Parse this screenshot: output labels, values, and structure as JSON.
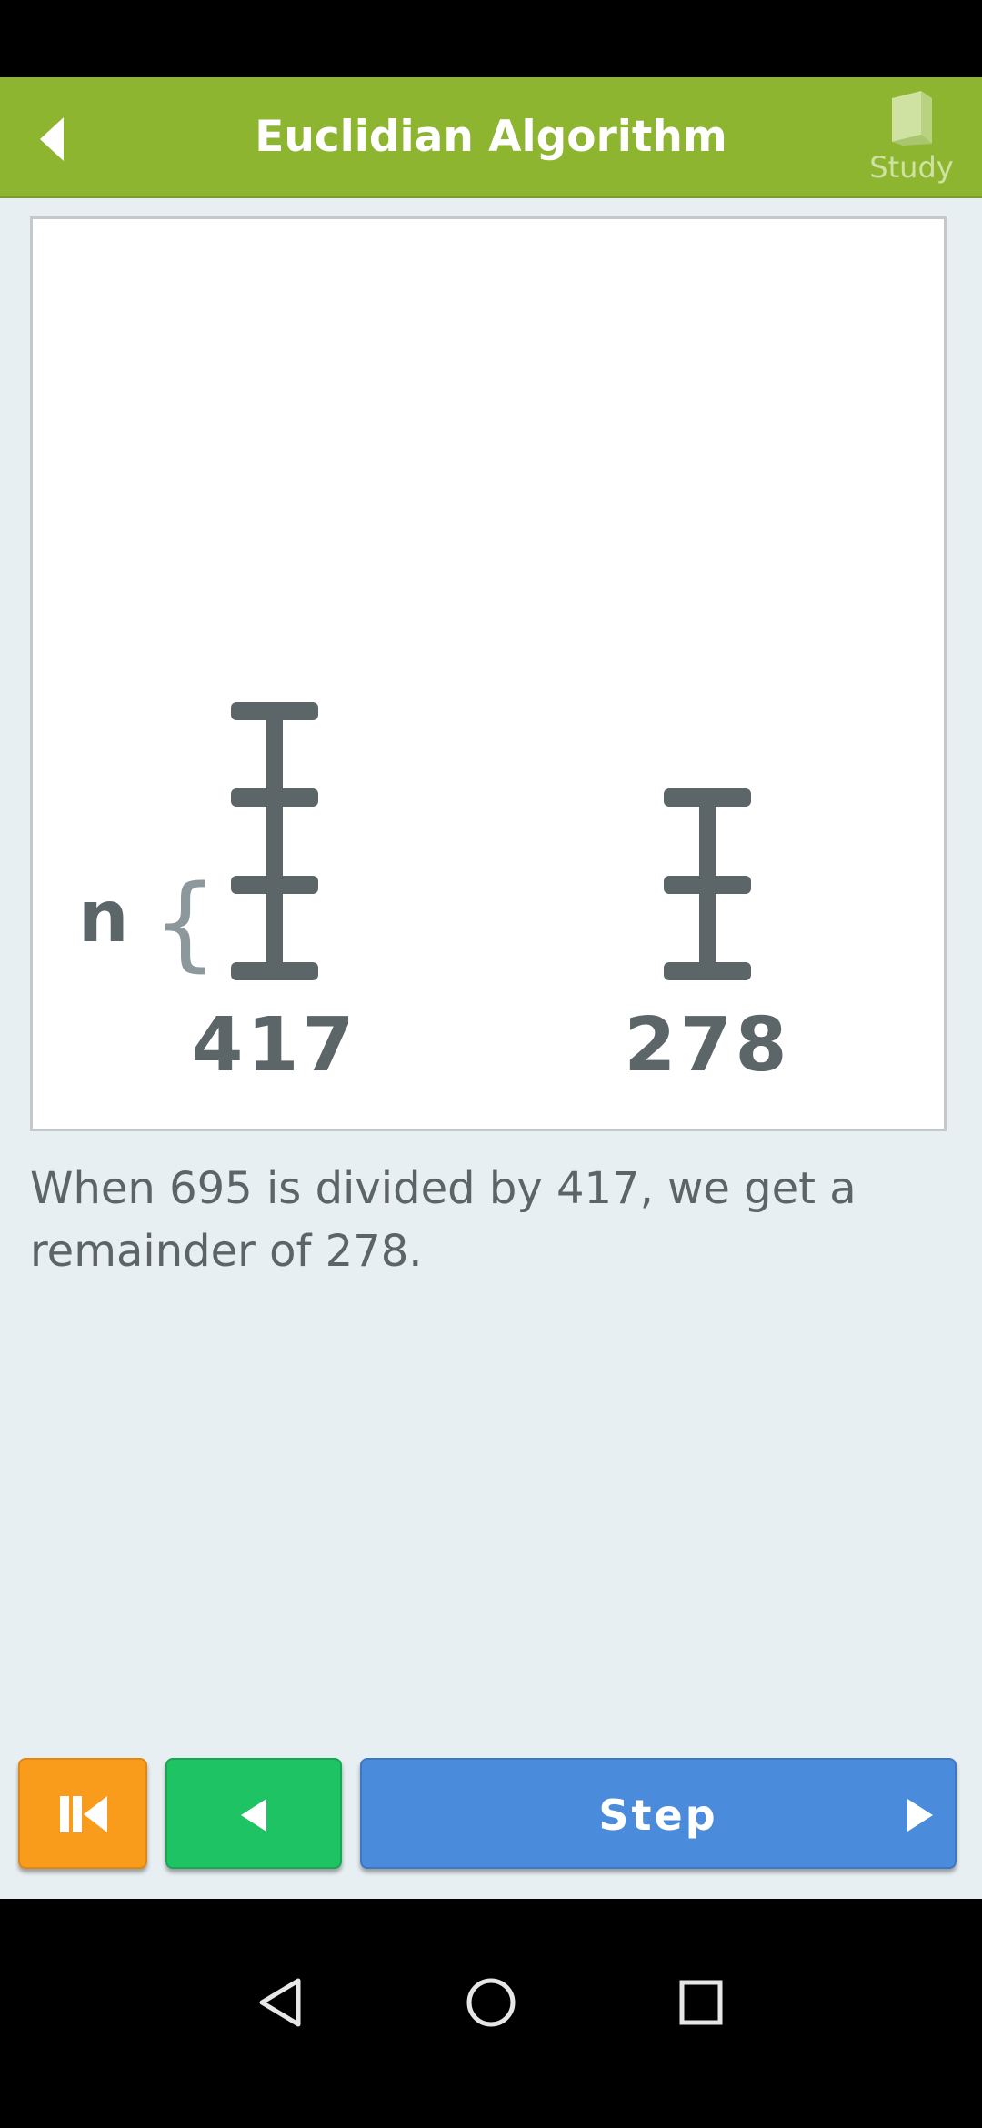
{
  "header": {
    "title": "Euclidian Algorithm",
    "study_label": "Study"
  },
  "visual": {
    "bracket_label": "n",
    "left_value": "417",
    "right_value": "278"
  },
  "description": "When 695 is divided by 417, we get a remainder of 278.",
  "controls": {
    "step_label": "Step"
  },
  "colors": {
    "app_bar": "#8db52f",
    "restart_button": "#f99b1b",
    "prev_button": "#1ec464",
    "step_button": "#4a8bdc",
    "ruler": "#5c6669"
  },
  "icons": {
    "back": "back-arrow-icon",
    "study": "book-icon",
    "restart": "skip-to-start-icon",
    "prev": "triangle-left-icon",
    "next": "triangle-right-icon"
  }
}
